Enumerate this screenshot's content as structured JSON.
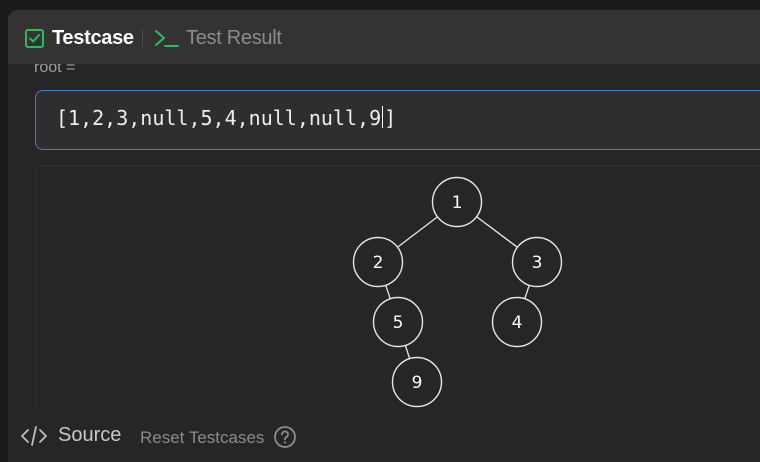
{
  "tabs": {
    "testcase_label": "Testcase",
    "result_label": "Test Result"
  },
  "param": {
    "label": "root =",
    "value_before_caret": "[1,2,3,null,5,4,null,null,9",
    "value_after_caret": "]"
  },
  "tree": {
    "nodes": [
      "1",
      "2",
      "3",
      "5",
      "4",
      "9"
    ]
  },
  "footer": {
    "source_label": "Source",
    "reset_label": "Reset Testcases"
  },
  "colors": {
    "testcase_icon": "#2cbb5d",
    "focus_border": "#3d7ec4",
    "panel_bg": "#262626"
  }
}
